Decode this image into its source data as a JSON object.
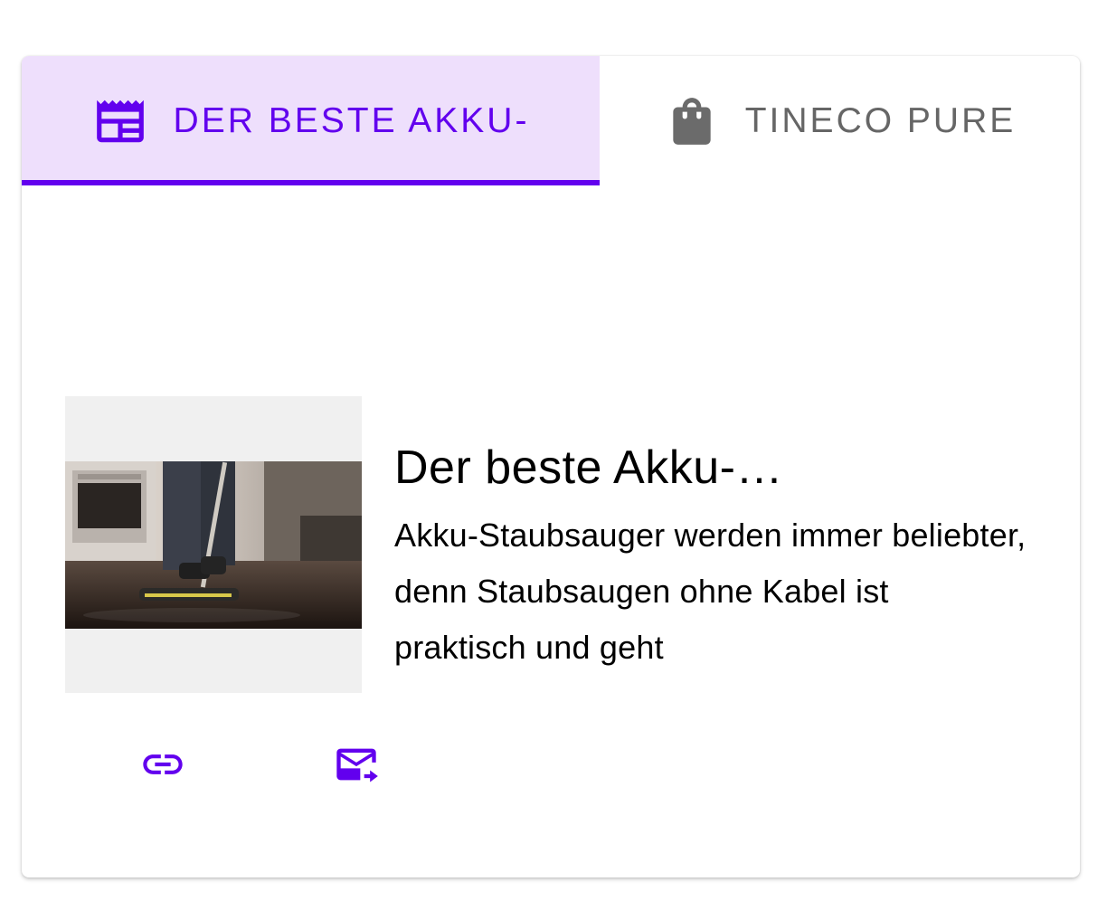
{
  "tabs": [
    {
      "label": "Der beste Akku-",
      "icon": "newspaper-icon",
      "active": true
    },
    {
      "label": "Tineco Pure",
      "icon": "shopping-bag-icon",
      "active": false
    }
  ],
  "article": {
    "title": "Der beste Akku-…",
    "snippet": "Akku-Staubsauger werden immer beliebter, denn Staubsaugen ohne Kabel ist praktisch und geht",
    "image": "cordless-vacuum-kitchen-photo"
  },
  "actions": [
    {
      "icon": "link-icon"
    },
    {
      "icon": "forward-email-icon"
    }
  ],
  "colors": {
    "accent": "#6200ee",
    "active_tab_bg": "#eedffc",
    "inactive_text": "#666666"
  }
}
